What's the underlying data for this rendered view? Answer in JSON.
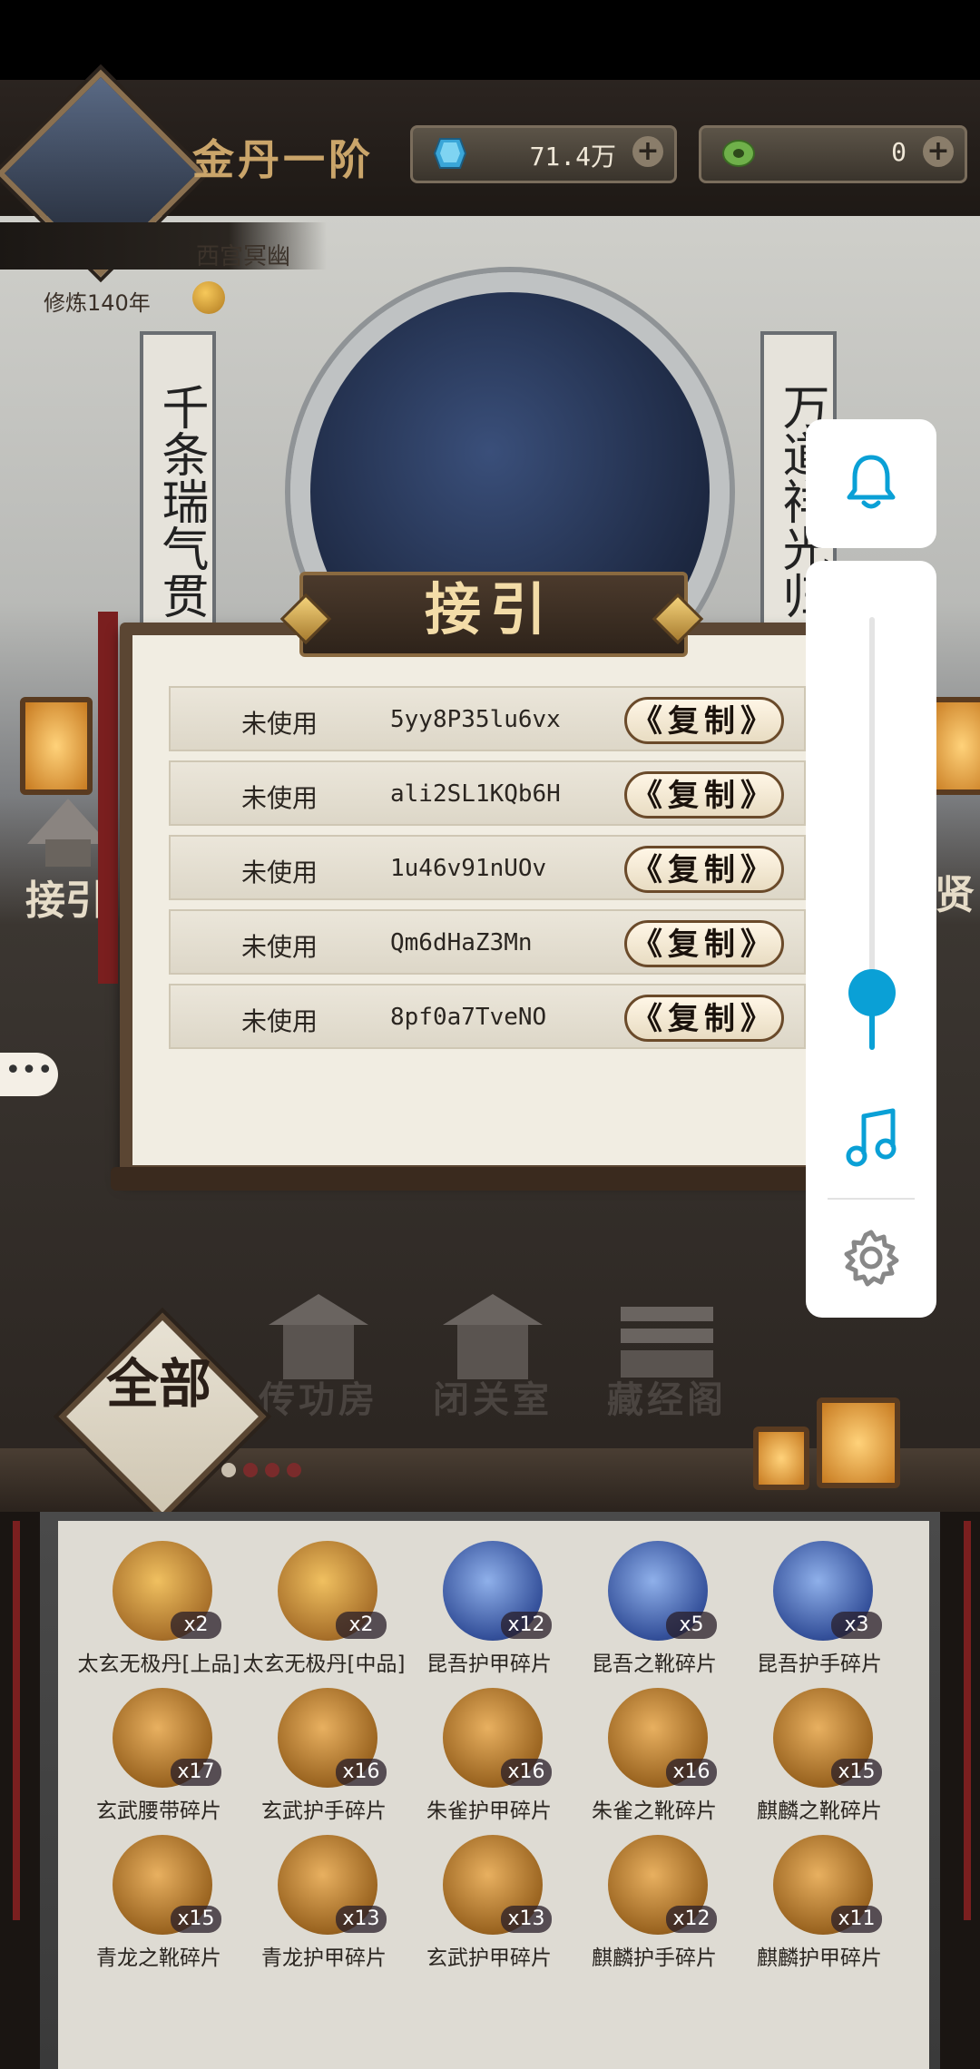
{
  "header": {
    "rank_title": "金丹一阶",
    "currencies": [
      {
        "icon": "blue-crystal-icon",
        "value": "71.4万"
      },
      {
        "icon": "jade-coin-icon",
        "value": "0"
      }
    ],
    "plus_label": "+",
    "location": "西宫冥幽",
    "cultivation_years": "修炼140年"
  },
  "scene": {
    "couplet_left": "千条瑞气贯",
    "couplet_right": "万道祥光归",
    "side_left_label": "接引",
    "side_right_label": "贤"
  },
  "chat_bubble": "•••",
  "modal": {
    "title": "接引",
    "rows": [
      {
        "status": "未使用",
        "code": "5yy8P35lu6vx",
        "copy": "《复制》"
      },
      {
        "status": "未使用",
        "code": "ali2SL1KQb6H",
        "copy": "《复制》"
      },
      {
        "status": "未使用",
        "code": "1u46v91nUOv",
        "copy": "《复制》"
      },
      {
        "status": "未使用",
        "code": "Qm6dHaZ3Mn",
        "copy": "《复制》"
      },
      {
        "status": "未使用",
        "code": "8pf0a7TveNO",
        "copy": "《复制》"
      }
    ]
  },
  "settings_panel": {
    "volume_level": 0.12,
    "accent": "#0aa0d6",
    "icons": [
      "bell-icon",
      "music-note-icon",
      "gear-icon"
    ]
  },
  "buildings": {
    "filter_all": "全部",
    "items": [
      "传功房",
      "闭关室",
      "藏经阁"
    ]
  },
  "inventory": {
    "items": [
      {
        "name": "太玄无极丹[上品]",
        "count": "x2",
        "style": "gold"
      },
      {
        "name": "太玄无极丹[中品]",
        "count": "x2",
        "style": "gold"
      },
      {
        "name": "昆吾护甲碎片",
        "count": "x12",
        "style": "blue"
      },
      {
        "name": "昆吾之靴碎片",
        "count": "x5",
        "style": "blue"
      },
      {
        "name": "昆吾护手碎片",
        "count": "x3",
        "style": "blue"
      },
      {
        "name": "玄武腰带碎片",
        "count": "x17",
        "style": "gold2"
      },
      {
        "name": "玄武护手碎片",
        "count": "x16",
        "style": "gold2"
      },
      {
        "name": "朱雀护甲碎片",
        "count": "x16",
        "style": "gold2"
      },
      {
        "name": "朱雀之靴碎片",
        "count": "x16",
        "style": "gold2"
      },
      {
        "name": "麒麟之靴碎片",
        "count": "x15",
        "style": "gold2"
      },
      {
        "name": "青龙之靴碎片",
        "count": "x15",
        "style": "gold2"
      },
      {
        "name": "青龙护甲碎片",
        "count": "x13",
        "style": "gold2"
      },
      {
        "name": "玄武护甲碎片",
        "count": "x13",
        "style": "gold2"
      },
      {
        "name": "麒麟护手碎片",
        "count": "x12",
        "style": "gold2"
      },
      {
        "name": "麒麟护甲碎片",
        "count": "x11",
        "style": "gold2"
      }
    ]
  }
}
